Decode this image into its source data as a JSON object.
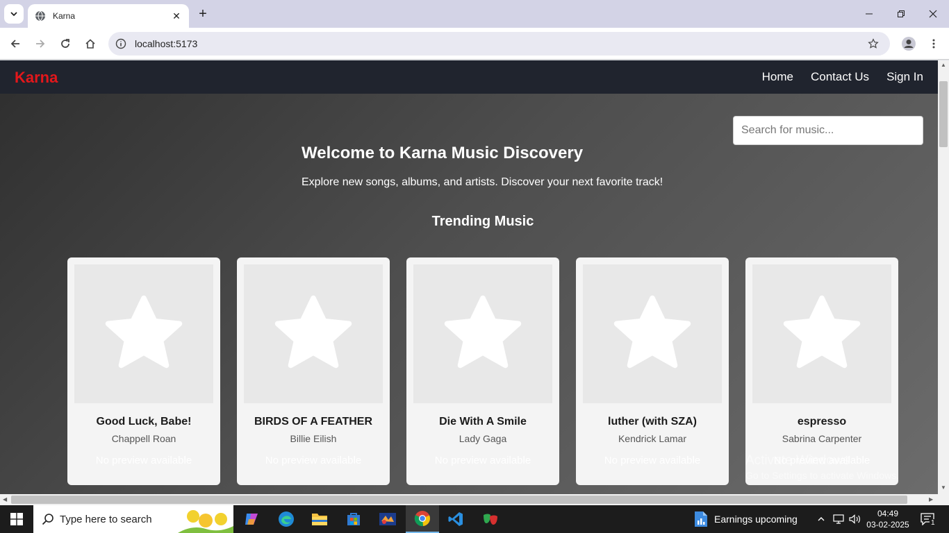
{
  "browser": {
    "tab_title": "Karna",
    "url": "localhost:5173"
  },
  "app": {
    "brand": "Karna",
    "nav": [
      "Home",
      "Contact Us",
      "Sign In"
    ],
    "search_placeholder": "Search for music...",
    "welcome_title": "Welcome to Karna Music Discovery",
    "welcome_subtitle": "Explore new songs, albums, and artists. Discover your next favorite track!",
    "section_title": "Trending Music",
    "tracks": [
      {
        "title": "Good Luck, Babe!",
        "artist": "Chappell Roan",
        "preview": "No preview available"
      },
      {
        "title": "BIRDS OF A FEATHER",
        "artist": "Billie Eilish",
        "preview": "No preview available"
      },
      {
        "title": "Die With A Smile",
        "artist": "Lady Gaga",
        "preview": "No preview available"
      },
      {
        "title": "luther (with SZA)",
        "artist": "Kendrick Lamar",
        "preview": "No preview available"
      },
      {
        "title": "espresso",
        "artist": "Sabrina Carpenter",
        "preview": "No preview available"
      }
    ]
  },
  "watermark": {
    "line1": "Activate Windows",
    "line2": "Go to Settings to activate Windows."
  },
  "taskbar": {
    "search_text": "Type here to search",
    "news": "Earnings upcoming",
    "time": "04:49",
    "date": "03-02-2025",
    "notifications": "1"
  },
  "colors": {
    "brand": "#e3171b",
    "appnav_bg": "#20242e",
    "card_bg": "#f4f4f4"
  }
}
